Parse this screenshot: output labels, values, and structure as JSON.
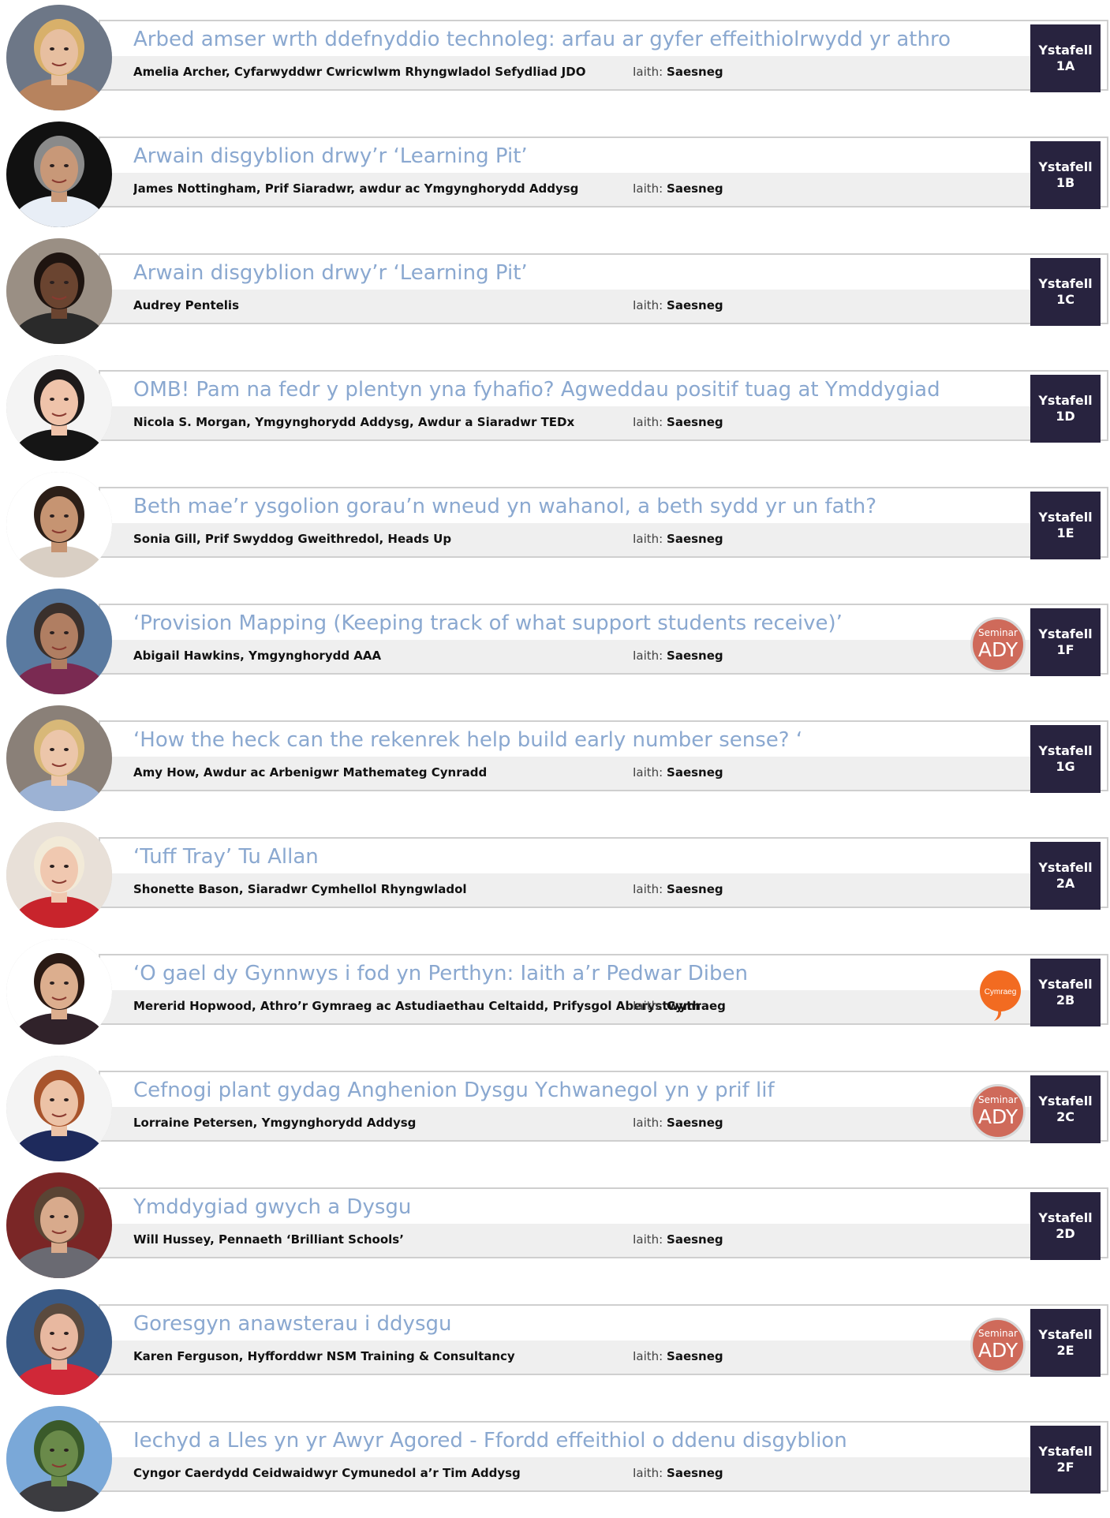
{
  "labels": {
    "language_prefix": "Iaith:",
    "seminar_small": "Seminar",
    "seminar_big": "ADY",
    "cymraeg_badge": "Cymraeg"
  },
  "colors": {
    "title": "#8aa8d0",
    "room_bg": "#28233f",
    "ady_badge": "#cf6a5a",
    "cymraeg_badge": "#f26b21"
  },
  "sessions": [
    {
      "title": "Arbed amser wrth ddefnyddio technoleg: arfau ar gyfer effeithiolrwydd yr athro",
      "speaker": "Amelia Archer, Cyfarwyddwr Cwricwlwm Rhyngwladol Sefydliad JDO",
      "language": "Saesneg",
      "room_line1": "Ystafell",
      "room_line2": "1A",
      "badge": "",
      "avatar": {
        "bg": "#6d7787",
        "skin": "#e7bfa0",
        "hair": "#d8b06a",
        "shirt": "#b7835e"
      }
    },
    {
      "title": "Arwain disgyblion drwy’r ‘Learning Pit’",
      "speaker": "James Nottingham, Prif Siaradwr, awdur ac Ymgynghorydd Addysg",
      "language": "Saesneg",
      "room_line1": "Ystafell",
      "room_line2": "1B",
      "badge": "",
      "avatar": {
        "bg": "#111111",
        "skin": "#c89878",
        "hair": "#8a8a8a",
        "shirt": "#e8eef6"
      }
    },
    {
      "title": "Arwain disgyblion drwy’r ‘Learning Pit’",
      "speaker": "Audrey Pentelis",
      "language": "Saesneg",
      "room_line1": "Ystafell",
      "room_line2": "1C",
      "badge": "",
      "avatar": {
        "bg": "#9a8f84",
        "skin": "#6a4430",
        "hair": "#1e1410",
        "shirt": "#2a2a2a"
      }
    },
    {
      "title": "OMB! Pam na fedr y plentyn yna fyhafio? Agweddau positif tuag at Ymddygiad",
      "speaker": "Nicola S. Morgan, Ymgynghorydd Addysg, Awdur a Siaradwr TEDx",
      "language": "Saesneg",
      "room_line1": "Ystafell",
      "room_line2": "1D",
      "badge": "",
      "avatar": {
        "bg": "#f4f4f4",
        "skin": "#efc3aa",
        "hair": "#1e1a1a",
        "shirt": "#151515"
      }
    },
    {
      "title": "Beth mae’r ysgolion gorau’n wneud yn wahanol, a beth sydd yr un fath?",
      "speaker": "Sonia Gill, Prif Swyddog Gweithredol, Heads Up",
      "language": "Saesneg",
      "room_line1": "Ystafell",
      "room_line2": "1E",
      "badge": "",
      "avatar": {
        "bg": "#ffffff",
        "skin": "#c69472",
        "hair": "#2c1f18",
        "shirt": "#d9cfc4"
      }
    },
    {
      "title": "‘Provision Mapping (Keeping track of what support students receive)’",
      "speaker": "Abigail Hawkins, Ymgynghorydd AAA",
      "language": "Saesneg",
      "room_line1": "Ystafell",
      "room_line2": "1F",
      "badge": "ady",
      "avatar": {
        "bg": "#5a7aa0",
        "skin": "#b07e62",
        "hair": "#3a302c",
        "shirt": "#7a2a52"
      }
    },
    {
      "title": "‘How the heck can the rekenrek help build early number sense? ‘",
      "speaker": "Amy How, Awdur ac Arbenigwr Mathemateg Cynradd",
      "language": "Saesneg",
      "room_line1": "Ystafell",
      "room_line2": "1G",
      "badge": "",
      "avatar": {
        "bg": "#8a8078",
        "skin": "#ecc6aa",
        "hair": "#d8b878",
        "shirt": "#9cb2d4"
      }
    },
    {
      "title": "‘Tuff Tray’ Tu Allan",
      "speaker": "Shonette Bason, Siaradwr Cymhellol Rhyngwladol",
      "language": "Saesneg",
      "room_line1": "Ystafell",
      "room_line2": "2A",
      "badge": "",
      "avatar": {
        "bg": "#e8e0d8",
        "skin": "#f0c8b0",
        "hair": "#f2ead8",
        "shirt": "#c8242c"
      }
    },
    {
      "title": "‘O gael dy Gynnwys i fod yn Perthyn: Iaith a’r Pedwar Diben",
      "speaker": "Mererid Hopwood, Athro’r Gymraeg ac Astudiaethau Celtaidd, Prifysgol Aberystwyth",
      "language": "Cymraeg",
      "room_line1": "Ystafell",
      "room_line2": "2B",
      "badge": "cymraeg",
      "avatar": {
        "bg": "#ffffff",
        "skin": "#dcae8e",
        "hair": "#2a1a14",
        "shirt": "#30222a"
      }
    },
    {
      "title": "Cefnogi plant gydag Anghenion Dysgu Ychwanegol yn y prif lif",
      "speaker": "Lorraine Petersen, Ymgynghorydd Addysg",
      "language": "Saesneg",
      "room_line1": "Ystafell",
      "room_line2": "2C",
      "badge": "ady",
      "avatar": {
        "bg": "#f4f4f4",
        "skin": "#ecc2a6",
        "hair": "#a8542c",
        "shirt": "#1e2a5c"
      }
    },
    {
      "title": "Ymddygiad gwych a Dysgu",
      "speaker": "Will Hussey, Pennaeth ‘Brilliant Schools’",
      "language": "Saesneg",
      "room_line1": "Ystafell",
      "room_line2": "2D",
      "badge": "",
      "avatar": {
        "bg": "#7a2626",
        "skin": "#d8aa8c",
        "hair": "#5a4434",
        "shirt": "#6a6a72"
      }
    },
    {
      "title": "Goresgyn anawsterau i ddysgu",
      "speaker": "Karen Ferguson, Hyfforddwr NSM Training & Consultancy",
      "language": "Saesneg",
      "room_line1": "Ystafell",
      "room_line2": "2E",
      "badge": "ady",
      "avatar": {
        "bg": "#3a5a86",
        "skin": "#e8b8a0",
        "hair": "#5a4a3e",
        "shirt": "#d02838"
      }
    },
    {
      "title": "Iechyd a Lles yn yr Awyr Agored - Ffordd effeithiol o ddenu disgyblion",
      "speaker": "Cyngor Caerdydd Ceidwaidwyr Cymunedol a’r Tim Addysg",
      "language": "Saesneg",
      "room_line1": "Ystafell",
      "room_line2": "2F",
      "badge": "",
      "avatar": {
        "bg": "#7aa8d8",
        "skin": "#6a8a4a",
        "hair": "#3a5a2a",
        "shirt": "#3c3c40"
      }
    }
  ]
}
